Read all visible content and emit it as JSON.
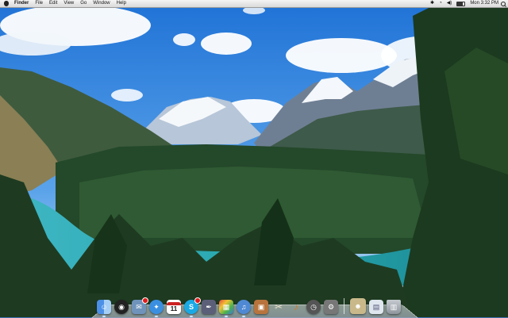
{
  "menubar": {
    "app_name": "Finder",
    "menus": [
      "File",
      "Edit",
      "View",
      "Go",
      "Window",
      "Help"
    ],
    "status": {
      "clock": "Mon 3:32 PM",
      "icons": [
        "apple-icon",
        "wifi-icon",
        "volume-icon",
        "battery-icon",
        "spotlight-icon"
      ]
    }
  },
  "desktop": {
    "wallpaper": "alpine lake and mountains"
  },
  "dock": {
    "calendar_day": "11",
    "items": [
      {
        "name": "finder",
        "color": "#3d7bd8"
      },
      {
        "name": "dashboard",
        "color": "#2a2a2a"
      },
      {
        "name": "mail",
        "color": "#6c8fb5",
        "badge": true
      },
      {
        "name": "safari",
        "color": "#3a8fe0"
      },
      {
        "name": "calendar",
        "color": "#ffffff"
      },
      {
        "name": "skype",
        "color": "#19a9e5",
        "badge": true
      },
      {
        "name": "app-store",
        "color": "#6a6a7a"
      },
      {
        "name": "photos",
        "color": "#d8a13c"
      },
      {
        "name": "itunes",
        "color": "#4f89d4"
      },
      {
        "name": "iphoto",
        "color": "#c0703a"
      },
      {
        "name": "preview",
        "color": "#d0a050"
      },
      {
        "name": "tools",
        "color": "#888888"
      },
      {
        "name": "garageband",
        "color": "#c07a2a"
      },
      {
        "name": "time-machine",
        "color": "#555555"
      },
      {
        "name": "system-preferences",
        "color": "#7a7a7a"
      },
      {
        "name": "user-folder",
        "color": "#c9b98a"
      },
      {
        "name": "downloads",
        "color": "#e0e6ec"
      },
      {
        "name": "trash",
        "color": "#aab0b6"
      }
    ]
  }
}
